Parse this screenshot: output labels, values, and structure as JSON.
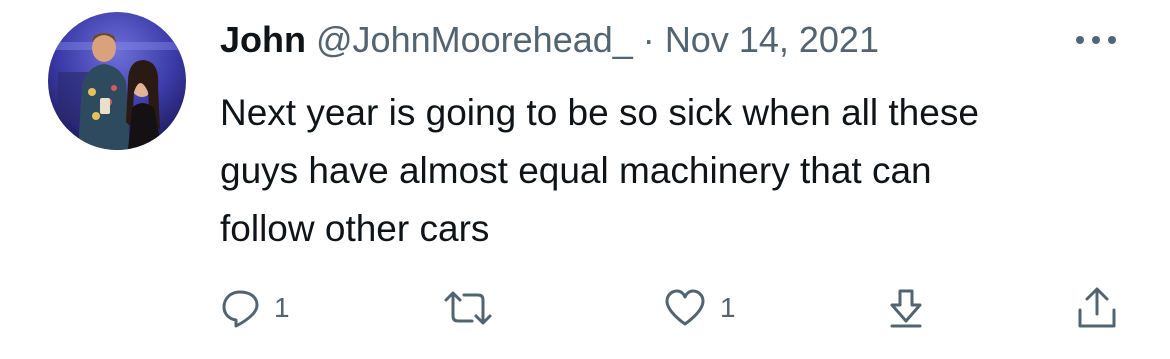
{
  "tweet": {
    "author_name": "John",
    "author_handle": "@JohnMoorehead_",
    "separator": "·",
    "date": "Nov 14, 2021",
    "text_lines": [
      "Next year is going to be so sick when all these",
      "guys have almost equal machinery that can",
      "follow other cars"
    ]
  },
  "actions": {
    "reply_count": "1",
    "retweet_count": "",
    "like_count": "1"
  },
  "icons": {
    "avatar": "avatar-photo",
    "more": "more-icon",
    "reply": "reply-icon",
    "retweet": "retweet-icon",
    "like": "like-icon",
    "bookmark": "bookmark-icon",
    "share": "share-icon"
  },
  "colors": {
    "text": "#0f1419",
    "secondary": "#536471",
    "background": "#ffffff"
  }
}
